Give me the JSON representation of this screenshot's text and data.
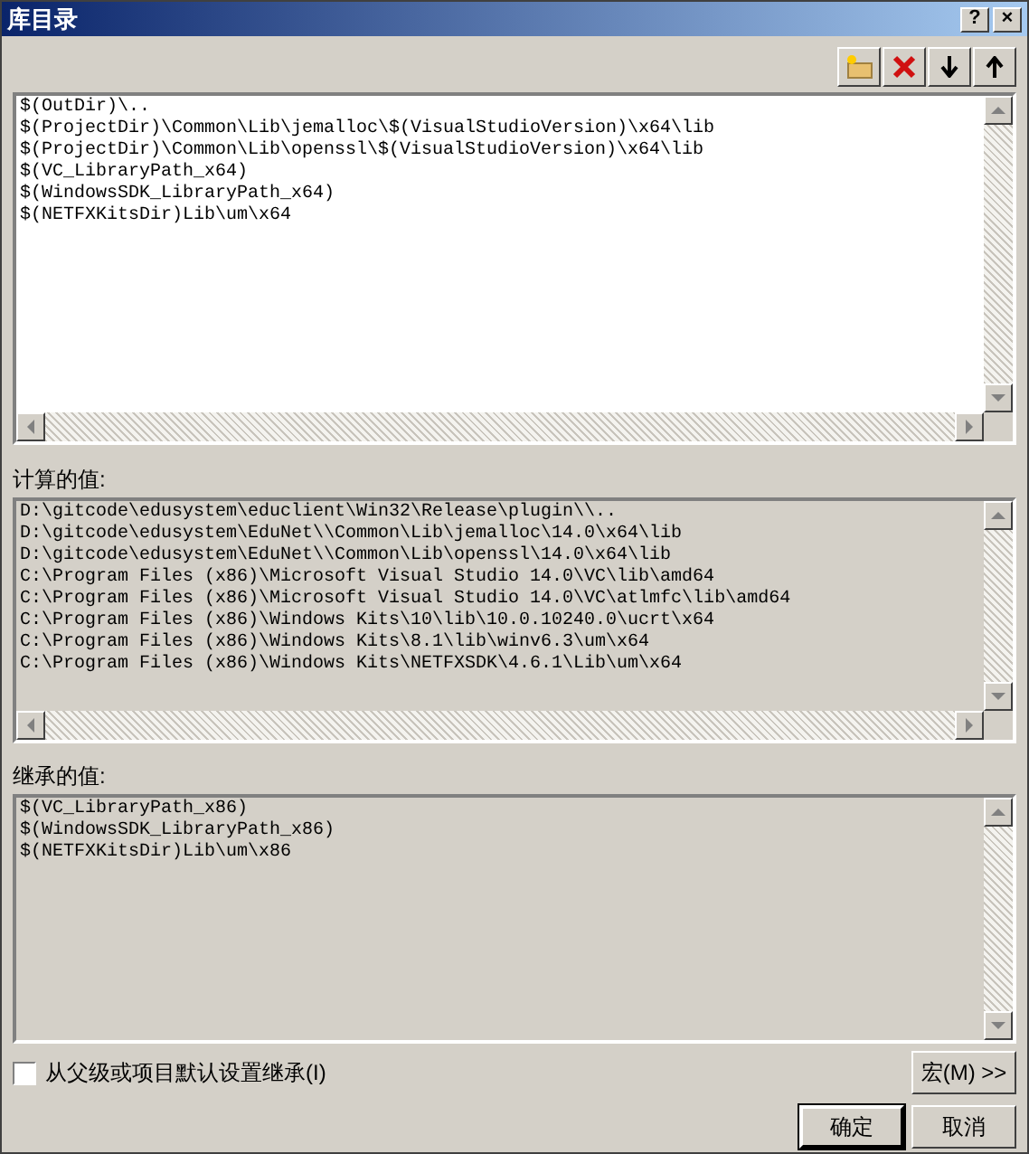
{
  "window": {
    "title": "库目录",
    "title_buttons": [
      "?",
      "×"
    ]
  },
  "directories": {
    "lines": [
      "$(OutDir)\\..",
      "$(ProjectDir)\\Common\\Lib\\jemalloc\\$(VisualStudioVersion)\\x64\\lib",
      "$(ProjectDir)\\Common\\Lib\\openssl\\$(VisualStudioVersion)\\x64\\lib",
      "$(VC_LibraryPath_x64)",
      "$(WindowsSDK_LibraryPath_x64)",
      "$(NETFXKitsDir)Lib\\um\\x64"
    ]
  },
  "evaluated": {
    "label": "计算的值:",
    "lines": [
      "D:\\gitcode\\edusystem\\educlient\\Win32\\Release\\plugin\\\\..",
      "D:\\gitcode\\edusystem\\EduNet\\\\Common\\Lib\\jemalloc\\14.0\\x64\\lib",
      "D:\\gitcode\\edusystem\\EduNet\\\\Common\\Lib\\openssl\\14.0\\x64\\lib",
      "C:\\Program Files (x86)\\Microsoft Visual Studio 14.0\\VC\\lib\\amd64",
      "C:\\Program Files (x86)\\Microsoft Visual Studio 14.0\\VC\\atlmfc\\lib\\amd64",
      "C:\\Program Files (x86)\\Windows Kits\\10\\lib\\10.0.10240.0\\ucrt\\x64",
      "C:\\Program Files (x86)\\Windows Kits\\8.1\\lib\\winv6.3\\um\\x64",
      "C:\\Program Files (x86)\\Windows Kits\\NETFXSDK\\4.6.1\\Lib\\um\\x64"
    ]
  },
  "inherited": {
    "label": "继承的值:",
    "lines": [
      "$(VC_LibraryPath_x86)",
      "$(WindowsSDK_LibraryPath_x86)",
      "$(NETFXKitsDir)Lib\\um\\x86"
    ]
  },
  "inherit_checkbox": {
    "label": "从父级或项目默认设置继承(I)",
    "checked": false
  },
  "macro_button": {
    "label": "宏(M) >>"
  },
  "buttons": [
    {
      "label": "确定",
      "default": true
    },
    {
      "label": "取消",
      "default": false
    }
  ]
}
